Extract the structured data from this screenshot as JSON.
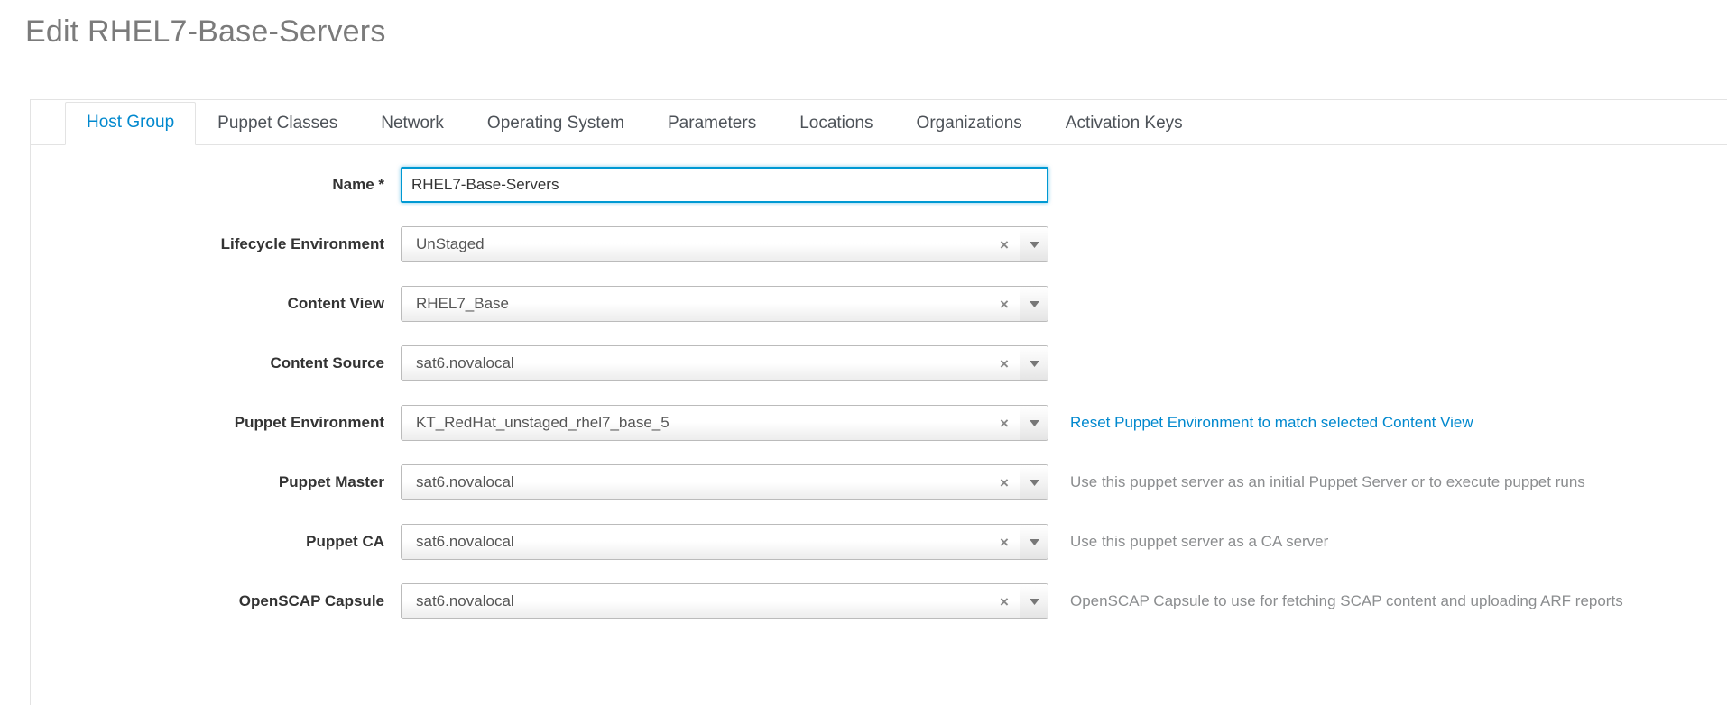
{
  "page": {
    "title": "Edit RHEL7-Base-Servers"
  },
  "tabs": [
    {
      "label": "Host Group",
      "name": "tab-host-group",
      "active": true
    },
    {
      "label": "Puppet Classes",
      "name": "tab-puppet-classes",
      "active": false
    },
    {
      "label": "Network",
      "name": "tab-network",
      "active": false
    },
    {
      "label": "Operating System",
      "name": "tab-operating-system",
      "active": false
    },
    {
      "label": "Parameters",
      "name": "tab-parameters",
      "active": false
    },
    {
      "label": "Locations",
      "name": "tab-locations",
      "active": false
    },
    {
      "label": "Organizations",
      "name": "tab-organizations",
      "active": false
    },
    {
      "label": "Activation Keys",
      "name": "tab-activation-keys",
      "active": false
    }
  ],
  "form": {
    "name_field": {
      "label": "Name *",
      "value": "RHEL7-Base-Servers",
      "placeholder": "",
      "focused": true
    },
    "lifecycle_environment": {
      "label": "Lifecycle Environment",
      "value": "UnStaged",
      "help": ""
    },
    "content_view": {
      "label": "Content View",
      "value": "RHEL7_Base",
      "help": ""
    },
    "content_source": {
      "label": "Content Source",
      "value": "sat6.novalocal",
      "help": ""
    },
    "puppet_environment": {
      "label": "Puppet Environment",
      "value": "KT_RedHat_unstaged_rhel7_base_5",
      "link": "Reset Puppet Environment to match selected Content View"
    },
    "puppet_master": {
      "label": "Puppet Master",
      "value": "sat6.novalocal",
      "help": "Use this puppet server as an initial Puppet Server or to execute puppet runs"
    },
    "puppet_ca": {
      "label": "Puppet CA",
      "value": "sat6.novalocal",
      "help": "Use this puppet server as a CA server"
    },
    "openscap_capsule": {
      "label": "OpenSCAP Capsule",
      "value": "sat6.novalocal",
      "help": "OpenSCAP Capsule to use for fetching SCAP content and uploading ARF reports"
    }
  },
  "icons": {
    "clear": "×",
    "dropdown": "▼"
  },
  "colors": {
    "accent": "#0088ce",
    "title": "#7b7b7b",
    "help_text": "#8b8d8f",
    "focus_border": "#0099d3"
  }
}
